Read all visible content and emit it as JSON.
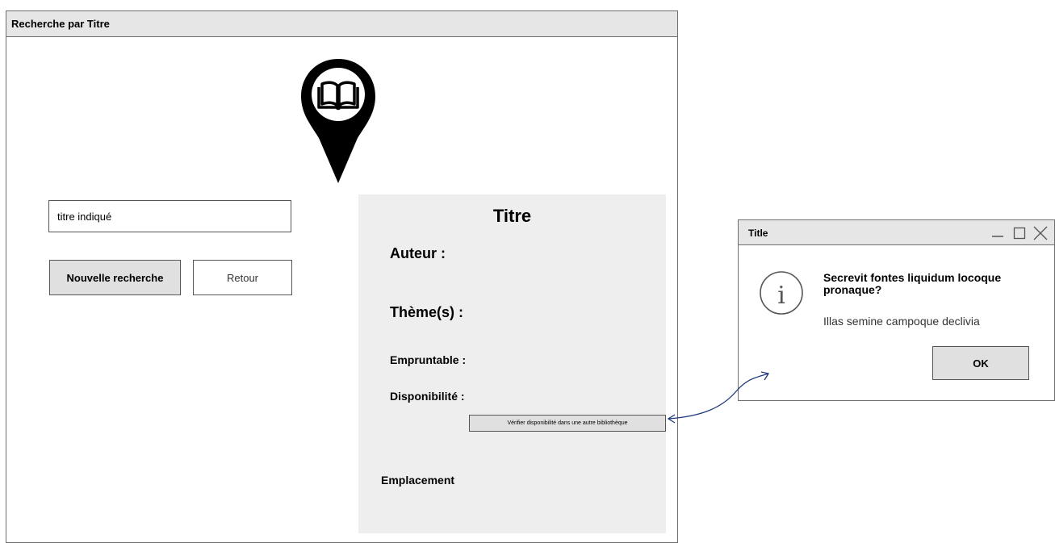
{
  "main_window": {
    "title": "Recherche par Titre",
    "logo_icon": "map-pin-book-icon",
    "search": {
      "value": "titre indiqué"
    },
    "buttons": {
      "new_search": "Nouvelle recherche",
      "back": "Retour"
    },
    "details": {
      "title": "Titre",
      "author_label": "Auteur :",
      "theme_label": "Thème(s) :",
      "borrowable_label": "Empruntable :",
      "availability_label": "Disponibilité :",
      "check_other_library": "Vérifier disponibilité dans une autre bibliothèque",
      "location_label": "Emplacement"
    }
  },
  "dialog": {
    "title": "Title",
    "window_controls": [
      "minimize-icon",
      "maximize-icon",
      "close-icon"
    ],
    "icon": "info-icon",
    "heading": "Secrevit fontes liquidum locoque pronaque?",
    "message": "Illas semine campoque declivia",
    "ok_label": "OK"
  },
  "colors": {
    "titlebar": "#e6e6e6",
    "panel": "#eeeeee",
    "button": "#e0e0e0",
    "border": "#6e6e6e",
    "connector": "#1f3a7a"
  }
}
